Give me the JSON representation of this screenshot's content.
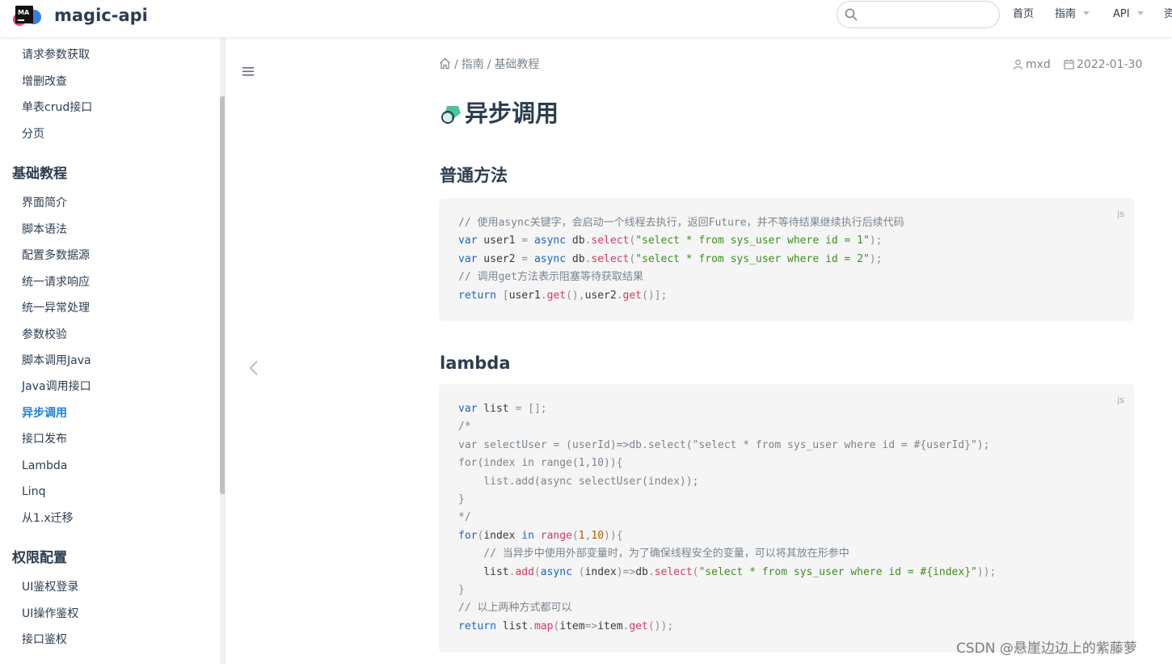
{
  "header": {
    "logo_text": "MA",
    "site_name": "magic-api",
    "search": {
      "value": "",
      "placeholder": ""
    },
    "nav": [
      {
        "label": "首页",
        "has_caret": false
      },
      {
        "label": "指南",
        "has_caret": true
      },
      {
        "label": "API",
        "has_caret": true
      },
      {
        "label": "资",
        "has_caret": false
      }
    ]
  },
  "sidebar": {
    "top_items": [
      "请求参数获取",
      "增删改查",
      "单表crud接口",
      "分页"
    ],
    "groups": [
      {
        "title": "基础教程",
        "items": [
          "界面简介",
          "脚本语法",
          "配置多数据源",
          "统一请求响应",
          "统一异常处理",
          "参数校验",
          "脚本调用Java",
          "Java调用接口",
          "异步调用",
          "接口发布",
          "Lambda",
          "Linq",
          "从1.x迁移"
        ]
      },
      {
        "title": "权限配置",
        "items": [
          "UI鉴权登录",
          "UI操作鉴权",
          "接口鉴权"
        ]
      }
    ],
    "active_item": "异步调用"
  },
  "breadcrumb": {
    "items": [
      "指南",
      "基础教程"
    ],
    "separator": "/"
  },
  "meta": {
    "author": "mxd",
    "date": "2022-01-30"
  },
  "page": {
    "title": "异步调用",
    "sections": [
      {
        "heading": "普通方法",
        "lang": "js",
        "lines": [
          "// 使用async关键字，会启动一个线程去执行，返回Future，并不等待结果继续执行后续代码",
          "var user1 = async db.select(\"select * from sys_user where id = 1\");",
          "var user2 = async db.select(\"select * from sys_user where id = 2\");",
          "// 调用get方法表示阻塞等待获取结果",
          "return [user1.get(),user2.get()];"
        ]
      },
      {
        "heading": "lambda",
        "lang": "js",
        "lines": [
          "var list = [];",
          "/*",
          "var selectUser = (userId)=>db.select(\"select * from sys_user where id = #{userId}\");",
          "for(index in range(1,10)){",
          "    list.add(async selectUser(index));",
          "}",
          "*/",
          "for(index in range(1,10)){",
          "    // 当异步中使用外部变量时，为了确保线程安全的变量，可以将其放在形参中",
          "    list.add(async (index)=>db.select(\"select * from sys_user where id = #{index}\"));",
          "}",
          "// 以上两种方式都可以",
          "return list.map(item=>item.get());"
        ]
      }
    ]
  },
  "watermark": "CSDN @悬崖边边上的紫藤萝",
  "colors": {
    "accent": "#1e7fd9",
    "text": "#2c3e50",
    "code_bg": "#f5f5f5"
  }
}
